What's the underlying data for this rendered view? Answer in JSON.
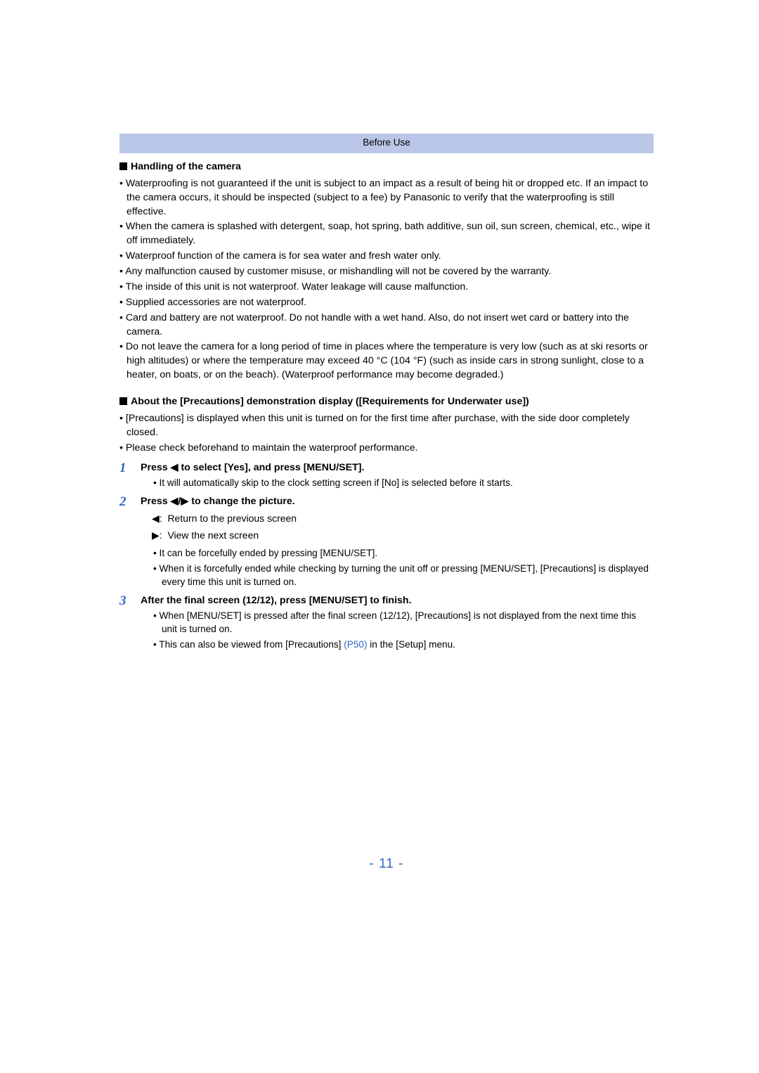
{
  "banner": "Before Use",
  "sections": {
    "handling": {
      "title": "Handling of the camera",
      "bullets": [
        "Waterproofing is not guaranteed if the unit is subject to an impact as a result of being hit or dropped etc. If an impact to the camera occurs, it should be inspected (subject to a fee) by Panasonic to verify that the waterproofing is still effective.",
        "When the camera is splashed with detergent, soap, hot spring, bath additive, sun oil, sun screen, chemical, etc., wipe it off immediately.",
        "Waterproof function of the camera is for sea water and fresh water only.",
        "Any malfunction caused by customer misuse, or mishandling will not be covered by the warranty.",
        "The inside of this unit is not waterproof. Water leakage will cause malfunction.",
        "Supplied accessories are not waterproof.",
        "Card and battery are not waterproof. Do not handle with a wet hand. Also, do not insert wet card or battery into the camera.",
        "Do not leave the camera for a long period of time in places where the temperature is very low (such as at ski resorts or high altitudes) or where the temperature may exceed 40 °C (104 °F) (such as inside cars in strong sunlight, close to a heater, on boats, or on the beach). (Waterproof performance may become degraded.)"
      ]
    },
    "precautions": {
      "title": "About the [Precautions] demonstration display ([Requirements for Underwater use])",
      "bullets": [
        "[Precautions] is displayed when this unit is turned on for the first time after purchase, with the side door completely closed.",
        "Please check beforehand to maintain the waterproof performance."
      ]
    }
  },
  "steps": {
    "s1": {
      "num": "1",
      "title": "Press ◀ to select [Yes], and press [MENU/SET].",
      "sub": [
        "It will automatically skip to the clock setting screen if [No] is selected before it starts."
      ]
    },
    "s2": {
      "num": "2",
      "title": "Press ◀/▶ to change the picture.",
      "arrows": {
        "left": "Return to the previous screen",
        "right": "View the next screen"
      },
      "sub": [
        "It can be forcefully ended by pressing [MENU/SET].",
        "When it is forcefully ended while checking by turning the unit off or pressing [MENU/SET], [Precautions] is displayed every time this unit is turned on."
      ]
    },
    "s3": {
      "num": "3",
      "title": "After the final screen (12/12), press [MENU/SET] to finish.",
      "sub1": "When [MENU/SET] is pressed after the final screen (12/12), [Precautions] is not displayed from the next time this unit is turned on.",
      "sub2_a": "This can also be viewed from [Precautions] ",
      "sub2_link": "(P50)",
      "sub2_b": " in the [Setup] menu."
    }
  },
  "pagenum": "- 11 -"
}
